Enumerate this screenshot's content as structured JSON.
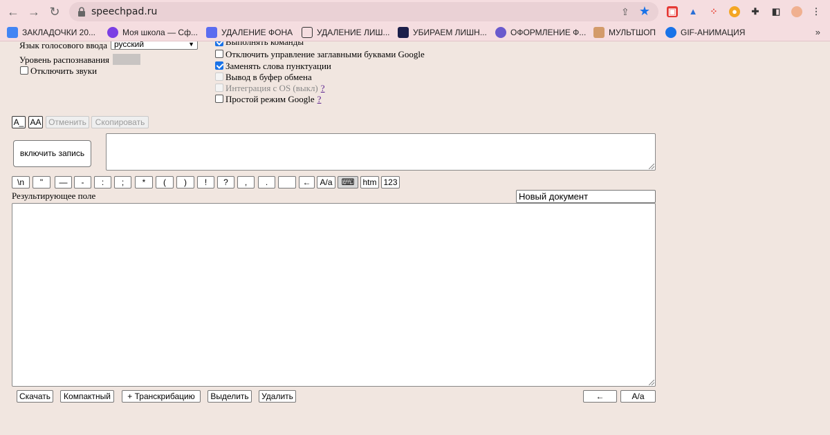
{
  "browser": {
    "url": "speechpad.ru",
    "bookmarks": [
      {
        "label": "ЗАКЛАДОЧКИ 20...",
        "color": "#4285f4"
      },
      {
        "label": "Моя школа — Сф...",
        "color": "#7b3fe4"
      },
      {
        "label": "УДАЛЕНИЕ ФОНА",
        "color": "#5b6cf0"
      },
      {
        "label": "УДАЛЕНИЕ ЛИШ...",
        "color": "#333333"
      },
      {
        "label": "УБИРАЕМ ЛИШН...",
        "color": "#1c1f4a"
      },
      {
        "label": "ОФОРМЛЕНИЕ Ф...",
        "color": "#6a5acd"
      },
      {
        "label": "МУЛЬТШОП",
        "color": "#d39b6a"
      },
      {
        "label": "GIF-АНИМАЦИЯ",
        "color": "#1a73e8"
      }
    ],
    "more": "»"
  },
  "settings": {
    "voice_lang_label": "Язык голосового ввода",
    "voice_lang_value": "русский",
    "recognition_level_label": "Уровень распознавания",
    "mute_sounds_label": "Отключить звуки",
    "execute_commands_label": "Выполнять команды",
    "disable_caps_label": "Отключить управление заглавными буквами Google",
    "replace_punct_label": "Заменять слова пунктуации",
    "clipboard_label": "Вывод в буфер обмена",
    "os_integration_label": "Интеграция с OS (выкл)",
    "simple_mode_label": "Простой режим Google",
    "help_mark": "?"
  },
  "editor_buttons": {
    "a_underscore": "A_",
    "aa": "AA",
    "undo": "Отменить",
    "copy": "Скопировать"
  },
  "record_button": "включить запись",
  "punct_buttons": [
    "\\n",
    "\"",
    "—",
    "-",
    ":",
    ";",
    "*",
    "(",
    ")",
    "!",
    "?",
    ",",
    ".",
    "",
    "←",
    "A/a"
  ],
  "extra_buttons": {
    "htm": "htm",
    "num": "123"
  },
  "result": {
    "label": "Результирующее поле",
    "doc_name": "Новый документ"
  },
  "bottom_buttons": {
    "download": "Скачать",
    "compact": "Компактный",
    "transcribe": "+ Транскрибацию",
    "select": "Выделить",
    "delete": "Удалить",
    "back": "←",
    "case": "A/a"
  }
}
